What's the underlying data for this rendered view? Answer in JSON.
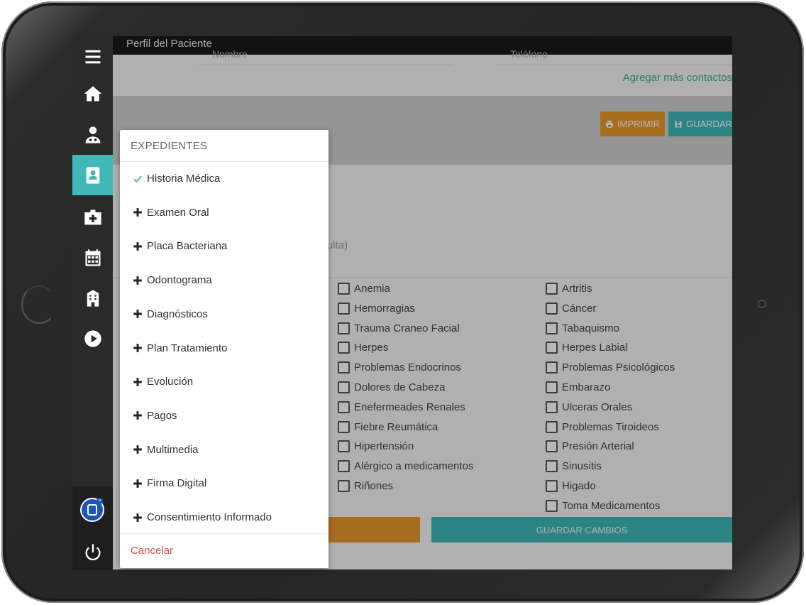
{
  "header": {
    "title": "Perfil del Paciente"
  },
  "contact": {
    "name_placeholder": "Nombre",
    "phone_placeholder": "Teléfono",
    "add_more_link": "Agregar más contactos"
  },
  "toolbar": {
    "print_label": "IMPRIMIR",
    "save_label": "GUARDAR"
  },
  "form": {
    "consulta_text": "nsulta)",
    "left_column": [
      "Anemia",
      "Hemorragias",
      "Trauma Craneo Facial",
      "Herpes",
      "Problemas Endocrinos",
      "Dolores de Cabeza",
      "Enefermeades Renales",
      "Fiebre Reumática",
      "Hipertensión",
      "Alérgico a medicamentos",
      "Riñones"
    ],
    "right_column": [
      "Artritis",
      "Cáncer",
      "Tabaquismo",
      "Herpes Labial",
      "Problemas Psicológicos",
      "Embarazo",
      "Ulceras Orales",
      "Problemas Tiroideos",
      "Presión Arterial",
      "Sinusitis",
      "Higado",
      "Toma Medicamentos"
    ],
    "save_changes_label": "GUARDAR CAMBIOS"
  },
  "menu": {
    "title": "EXPEDIENTES",
    "items": [
      {
        "label": "Historia Médica",
        "icon": "check-icon"
      },
      {
        "label": "Examen Oral",
        "icon": "plus-icon"
      },
      {
        "label": "Placa Bacteriana",
        "icon": "plus-icon"
      },
      {
        "label": "Odontograma",
        "icon": "plus-icon"
      },
      {
        "label": "Diagnósticos",
        "icon": "plus-icon"
      },
      {
        "label": "Plan Tratamiento",
        "icon": "plus-icon"
      },
      {
        "label": "Evolución",
        "icon": "plus-icon"
      },
      {
        "label": "Pagos",
        "icon": "plus-icon"
      },
      {
        "label": "Multimedia",
        "icon": "plus-icon"
      },
      {
        "label": "Firma Digital",
        "icon": "plus-icon"
      },
      {
        "label": "Consentimiento Informado",
        "icon": "plus-icon"
      }
    ],
    "cancel_label": "Cancelar"
  },
  "sidebar": {
    "items": [
      "menu-icon",
      "home-icon",
      "doctor-icon",
      "patient-card-icon",
      "medical-kit-icon",
      "calendar-icon",
      "building-icon",
      "play-icon"
    ],
    "active_index": 3,
    "bottom": [
      "app-logo-icon",
      "power-icon"
    ]
  },
  "colors": {
    "accent": "#41b8b8",
    "warning": "#e8972c",
    "danger": "#d9534f",
    "sidebar": "#2a2a2a"
  }
}
